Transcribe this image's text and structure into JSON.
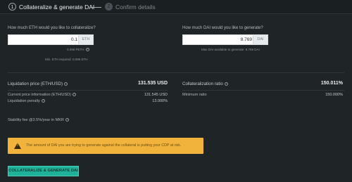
{
  "steps": [
    {
      "num": "1",
      "label": "Collateralize & generate DAI"
    },
    {
      "num": "2",
      "label": "Confirm details"
    }
  ],
  "eth": {
    "question": "How much ETH would you like to collateralize?",
    "value": "0.1",
    "unit": "ETH",
    "peth": "0.096 PETH",
    "min_required": "Min. ETH required: 0.096 ETH"
  },
  "dai": {
    "question": "How much DAI would you like to generate?",
    "value": "8.769",
    "unit": "DAI",
    "max_available": "Max DAI available to generate: 8.769 DAI"
  },
  "stats": {
    "liquidation_price_label": "Liquidation price (ETH/USD)",
    "liquidation_price_value": "131.535 USD",
    "current_price_label": "Current price information (ETH/USD)",
    "current_price_value": "131.545 USD",
    "liquidation_penalty_label": "Liquidation penalty",
    "liquidation_penalty_value": "13.000%",
    "collat_ratio_label": "Collateralization ratio",
    "collat_ratio_value": "150.011%",
    "min_ratio_label": "Minimum ratio",
    "min_ratio_value": "150.000%",
    "stability_fee": "Stability fee @3.5%/year in MKR"
  },
  "warning": {
    "icon": "warning-triangle-icon",
    "text": "The amount of DAI you are trying to generate against the collateral is putting your CDP at risk."
  },
  "cta": {
    "label": "COLLATERALIZE & GENERATE DAI"
  },
  "colors": {
    "background": "#1f2427",
    "accent": "#1fb199",
    "warning": "#f2b33d"
  }
}
